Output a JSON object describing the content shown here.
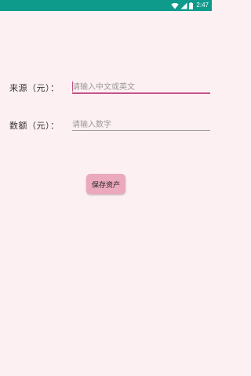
{
  "status_bar": {
    "time": "2:47",
    "icons": [
      "wifi-icon",
      "signal-icon",
      "battery-icon"
    ]
  },
  "form": {
    "source": {
      "label": "来源（元）：",
      "placeholder": "请输入中文或英文",
      "value": ""
    },
    "amount": {
      "label": "数额（元）：",
      "placeholder": "请输入数字",
      "value": ""
    }
  },
  "actions": {
    "save_label": "保存资产"
  },
  "colors": {
    "status_bar": "#0e9b8c",
    "background": "#fdf0f2",
    "accent": "#c2548a",
    "button": "#eba9bd"
  }
}
